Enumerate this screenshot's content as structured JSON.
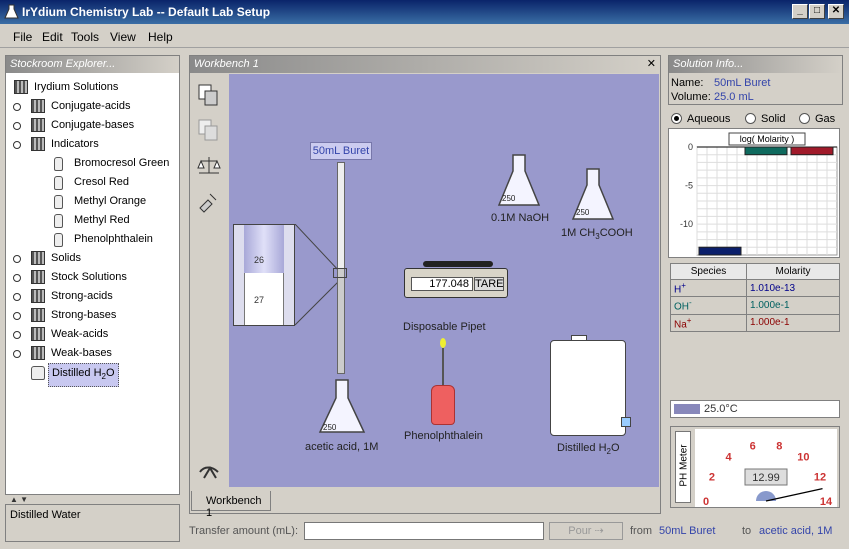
{
  "window": {
    "title": "IrYdium Chemistry Lab -- Default Lab Setup",
    "min": "_",
    "max": "□",
    "close": "✕"
  },
  "menu": [
    "File",
    "Edit",
    "Tools",
    "View",
    "Help"
  ],
  "stockroom": {
    "title": "Stockroom Explorer...",
    "items": [
      {
        "label": "Irydium Solutions",
        "level": 0,
        "type": "shelf"
      },
      {
        "label": "Conjugate-acids",
        "level": 1,
        "type": "shelf",
        "expander": true
      },
      {
        "label": "Conjugate-bases",
        "level": 1,
        "type": "shelf",
        "expander": true
      },
      {
        "label": "Indicators",
        "level": 1,
        "type": "shelf",
        "expander": true
      },
      {
        "label": "Bromocresol Green",
        "level": 2,
        "type": "bottle"
      },
      {
        "label": "Cresol Red",
        "level": 2,
        "type": "bottle"
      },
      {
        "label": "Methyl Orange",
        "level": 2,
        "type": "bottle"
      },
      {
        "label": "Methyl Red",
        "level": 2,
        "type": "bottle"
      },
      {
        "label": "Phenolphthalein",
        "level": 2,
        "type": "bottle"
      },
      {
        "label": "Solids",
        "level": 1,
        "type": "shelf",
        "expander": true
      },
      {
        "label": "Stock Solutions",
        "level": 1,
        "type": "shelf",
        "expander": true
      },
      {
        "label": "Strong-acids",
        "level": 1,
        "type": "shelf",
        "expander": true
      },
      {
        "label": "Strong-bases",
        "level": 1,
        "type": "shelf",
        "expander": true
      },
      {
        "label": "Weak-acids",
        "level": 1,
        "type": "shelf",
        "expander": true
      },
      {
        "label": "Weak-bases",
        "level": 1,
        "type": "shelf",
        "expander": true
      },
      {
        "label": "Distilled H",
        "sub": "2",
        "suffix": "O",
        "level": 1,
        "type": "jug",
        "selected": true
      }
    ],
    "status": "Distilled Water"
  },
  "workbench": {
    "title": "Workbench 1",
    "close": "✕",
    "tab": "Workbench 1",
    "buret_label": "50mL Buret",
    "buret_marks": [
      "26",
      "27"
    ],
    "flask_buret_label": "acetic acid, 1M",
    "flask_naoh": "0.1M NaOH",
    "flask_ch3": "1M CH",
    "flask_ch3_sub": "3",
    "flask_ch3_rest": "COOH",
    "flask_mark": "250",
    "scale_value": "177.048",
    "scale_tare": "TARE",
    "pipet_label": "Disposable Pipet",
    "phenol_label": "Phenolphthalein",
    "water_label": "Distilled H",
    "water_sub": "2",
    "water_suffix": "O"
  },
  "solution": {
    "title": "Solution Info...",
    "name_label": "Name:",
    "name_value": "50mL Buret",
    "volume_label": "Volume:",
    "volume_value": "25.0 mL",
    "phases": [
      "Aqueous",
      "Solid",
      "Gas"
    ],
    "selected_phase": "Aqueous",
    "chart_title": "log( Molarity )",
    "temperature": "25.0°C",
    "ph_label": "PH Meter",
    "ph_value": "12.99",
    "species_header": [
      "Species",
      "Molarity"
    ],
    "species": [
      {
        "name": "H",
        "sup": "+",
        "molarity": "1.010e-13",
        "color": "#00008b"
      },
      {
        "name": "OH",
        "sup": "-",
        "molarity": "1.000e-1",
        "color": "#006060"
      },
      {
        "name": "Na",
        "sup": "+",
        "molarity": "1.000e-1",
        "color": "#8b0000"
      }
    ]
  },
  "chart_data": {
    "type": "bar",
    "title": "log( Molarity )",
    "categories": [
      "H+",
      "OH-",
      "Na+"
    ],
    "values": [
      -12.99,
      -1,
      -1
    ],
    "yticks": [
      "0",
      "-5",
      "-10"
    ],
    "ylim": [
      -14,
      0
    ],
    "colors": [
      "#0b1f6b",
      "#0f6a5e",
      "#a01a2a"
    ]
  },
  "ph_dial": {
    "ticks": [
      "0",
      "2",
      "4",
      "6",
      "8",
      "10",
      "12",
      "14"
    ],
    "value": 12.99
  },
  "transfer": {
    "label": "Transfer amount (mL):",
    "value": "",
    "pour": "Pour",
    "from_label": "from",
    "from_value": "50mL Buret",
    "to_label": "to",
    "to_value": "acetic acid, 1M"
  }
}
